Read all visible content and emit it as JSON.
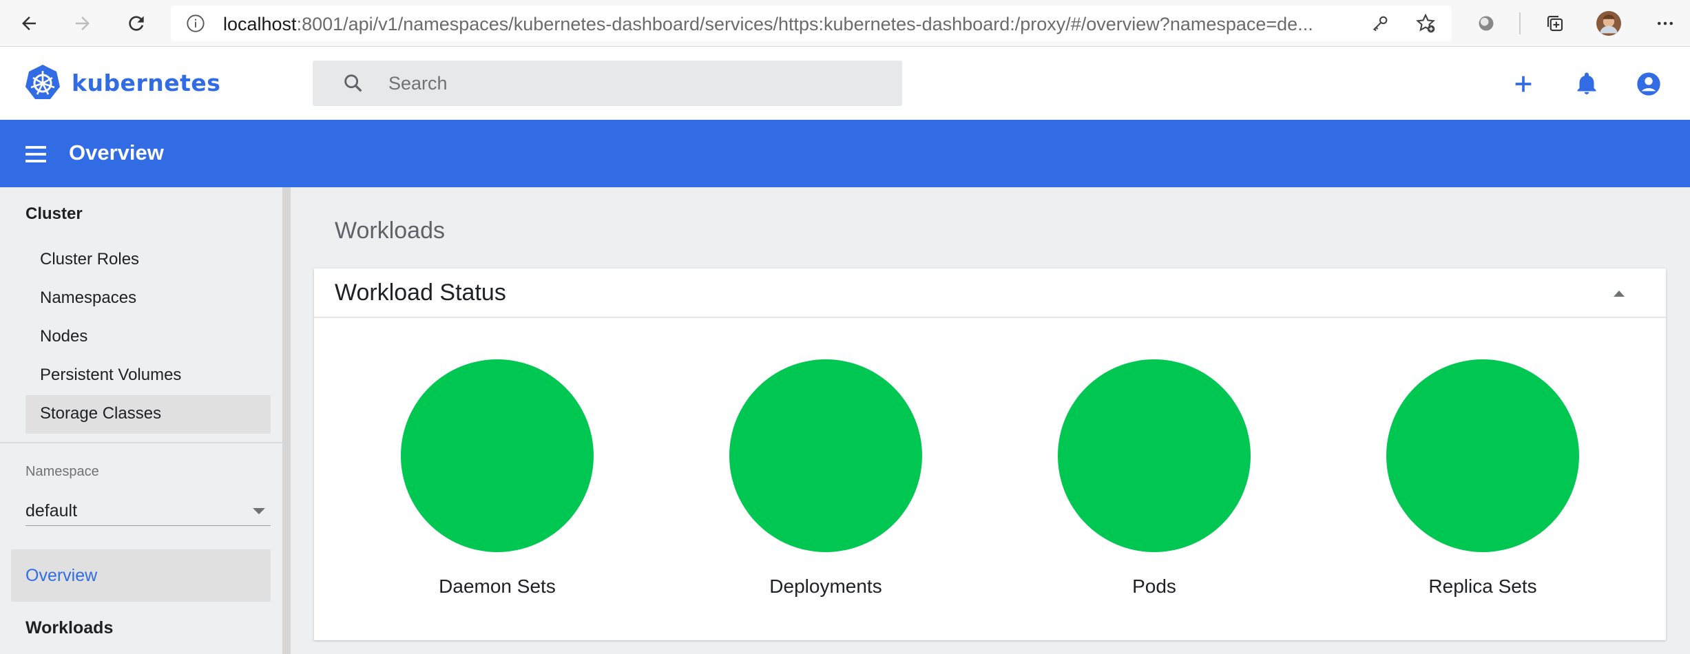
{
  "browser": {
    "url_host": "localhost",
    "url_rest": ":8001/api/v1/namespaces/kubernetes-dashboard/services/https:kubernetes-dashboard:/proxy/#/overview?namespace=de..."
  },
  "header": {
    "brand": "kubernetes",
    "brand_color": "#326ce5",
    "search_placeholder": "Search"
  },
  "toolbar": {
    "title": "Overview",
    "color": "#326ce5"
  },
  "sidebar": {
    "cluster_heading": "Cluster",
    "cluster_items": [
      {
        "label": "Cluster Roles"
      },
      {
        "label": "Namespaces"
      },
      {
        "label": "Nodes"
      },
      {
        "label": "Persistent Volumes"
      },
      {
        "label": "Storage Classes"
      }
    ],
    "namespace_label": "Namespace",
    "namespace_value": "default",
    "overview_label": "Overview",
    "workloads_heading": "Workloads"
  },
  "main": {
    "section_title": "Workloads",
    "card_title": "Workload Status",
    "status_color": "#00c752",
    "statuses": [
      {
        "label": "Daemon Sets"
      },
      {
        "label": "Deployments"
      },
      {
        "label": "Pods"
      },
      {
        "label": "Replica Sets"
      }
    ]
  }
}
